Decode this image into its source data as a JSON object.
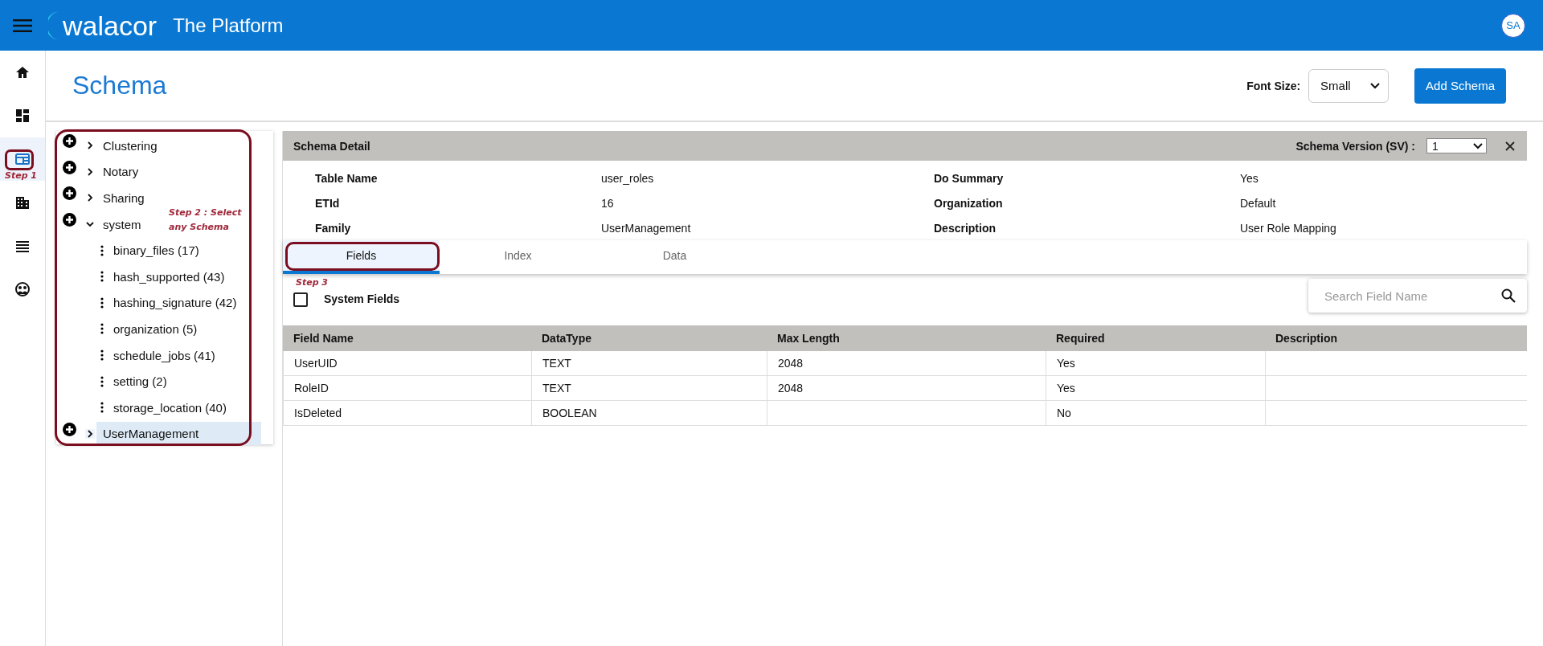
{
  "header": {
    "brand": "walacor",
    "title": "The Platform",
    "avatar": "SA"
  },
  "rail": [
    {
      "kind": "home",
      "selected": false
    },
    {
      "kind": "dashboard",
      "selected": false
    },
    {
      "kind": "schema",
      "selected": true,
      "annotation": "Step 1"
    },
    {
      "kind": "building",
      "selected": false
    },
    {
      "kind": "list",
      "selected": false
    },
    {
      "kind": "globe",
      "selected": false
    }
  ],
  "page": {
    "title": "Schema",
    "font_size_label": "Font Size:",
    "font_size_value": "Small",
    "add_button": "Add Schema"
  },
  "tree": {
    "annotation": "Step 2 : Select any Schema",
    "items": [
      {
        "label": "Clustering",
        "expanded": false,
        "selected": false
      },
      {
        "label": "Notary",
        "expanded": false,
        "selected": false
      },
      {
        "label": "Sharing",
        "expanded": false,
        "selected": false
      },
      {
        "label": "system",
        "expanded": true,
        "selected": false,
        "children": [
          {
            "label": "binary_files (17)"
          },
          {
            "label": "hash_supported (43)"
          },
          {
            "label": "hashing_signature (42)"
          },
          {
            "label": "organization (5)"
          },
          {
            "label": "schedule_jobs (41)"
          },
          {
            "label": "setting (2)"
          },
          {
            "label": "storage_location (40)"
          }
        ]
      },
      {
        "label": "UserManagement",
        "expanded": false,
        "selected": true
      }
    ]
  },
  "detail": {
    "title": "Schema Detail",
    "version_label": "Schema Version (SV) :",
    "version_value": "1",
    "left": [
      {
        "label": "Table Name",
        "value": "user_roles"
      },
      {
        "label": "ETId",
        "value": "16"
      },
      {
        "label": "Family",
        "value": "UserManagement"
      }
    ],
    "right": [
      {
        "label": "Do Summary",
        "value": "Yes"
      },
      {
        "label": "Organization",
        "value": "Default"
      },
      {
        "label": "Description",
        "value": "User Role Mapping"
      }
    ]
  },
  "tabs": {
    "annotation": "Step 3",
    "items": [
      {
        "label": "Fields",
        "selected": true
      },
      {
        "label": "Index",
        "selected": false
      },
      {
        "label": "Data",
        "selected": false
      }
    ]
  },
  "system_fields": {
    "label": "System Fields",
    "checked": false
  },
  "search": {
    "placeholder": "Search Field Name"
  },
  "table": {
    "columns": [
      "Field Name",
      "DataType",
      "Max Length",
      "Required",
      "Description"
    ],
    "rows": [
      [
        "UserUID",
        "TEXT",
        "2048",
        "Yes",
        null
      ],
      [
        "RoleID",
        "TEXT",
        "2048",
        "Yes",
        null
      ],
      [
        "IsDeleted",
        "BOOLEAN",
        null,
        "No",
        null
      ]
    ]
  }
}
